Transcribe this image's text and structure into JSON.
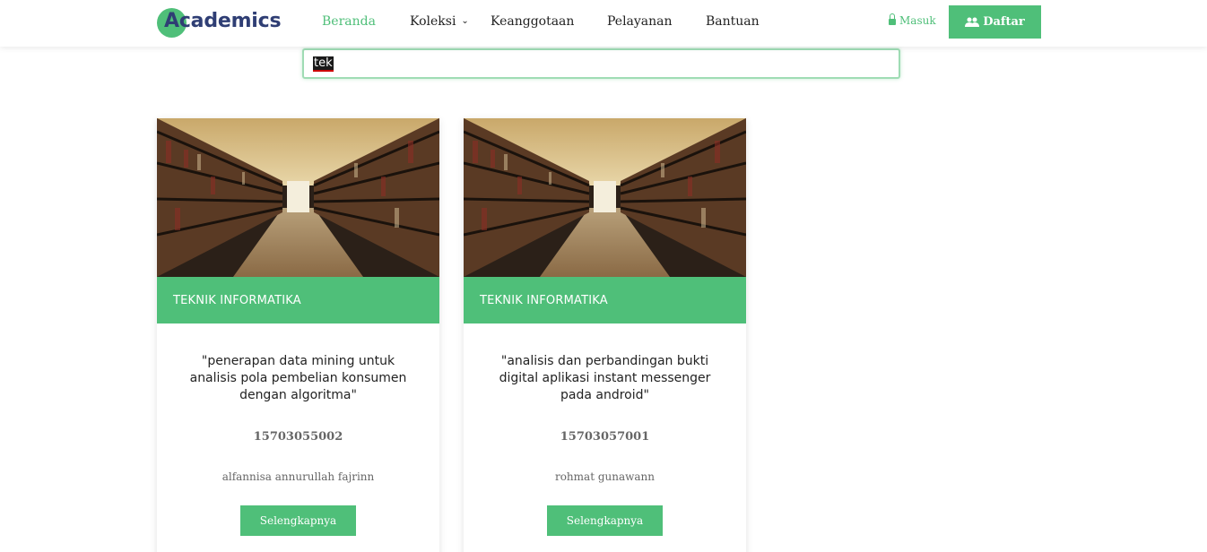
{
  "header": {
    "logo_text": "Academics",
    "nav": [
      {
        "label": "Beranda",
        "active": true
      },
      {
        "label": "Koleksi",
        "dropdown": true
      },
      {
        "label": "Keanggotaan"
      },
      {
        "label": "Pelayanan"
      },
      {
        "label": "Bantuan"
      }
    ],
    "login_label": "Masuk",
    "register_label": "Daftar"
  },
  "search": {
    "value": "tek"
  },
  "cards": [
    {
      "category": "TEKNIK INFORMATIKA",
      "title": "\"penerapan data mining untuk analisis pola pembelian konsumen dengan algoritma\"",
      "id": "15703055002",
      "author": "alfannisa annurullah fajrinn",
      "button_label": "Selengkapnya"
    },
    {
      "category": "TEKNIK INFORMATIKA",
      "title": "\"analisis dan perbandingan bukti digital aplikasi instant messenger pada android\"",
      "id": "15703057001",
      "author": "rohmat gunawann",
      "button_label": "Selengkapnya"
    }
  ],
  "colors": {
    "accent": "#4fbf79",
    "logo": "#2f3e74"
  }
}
